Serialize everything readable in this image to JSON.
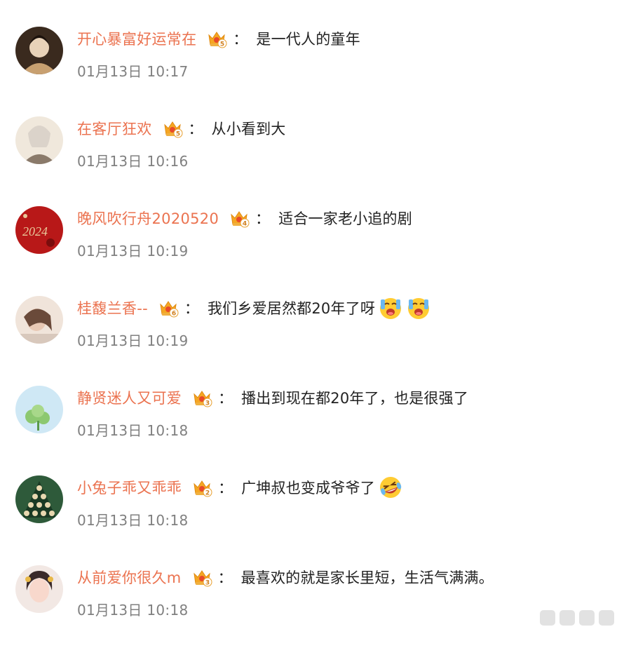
{
  "comments": [
    {
      "username": "开心暴富好运常在",
      "level": "5",
      "text": "是一代人的童年",
      "time": "01月13日 10:17",
      "emojis": [],
      "avatar_colors": [
        "#3a2a1e",
        "#c8a070",
        "#e8d2b8"
      ]
    },
    {
      "username": "在客厅狂欢",
      "level": "5",
      "text": "从小看到大",
      "time": "01月13日 10:16",
      "emojis": [],
      "avatar_colors": [
        "#d8d0c8",
        "#f0e8dc",
        "#8a7a6a"
      ]
    },
    {
      "username": "晚风吹行舟2020520",
      "level": "4",
      "text": "适合一家老小追的剧",
      "time": "01月13日 10:19",
      "emojis": [],
      "avatar_colors": [
        "#b81818",
        "#e8c89a",
        "#7a0d0d"
      ]
    },
    {
      "username": "桂馥兰香--",
      "level": "6",
      "text": "我们乡爱居然都20年了呀",
      "time": "01月13日 10:19",
      "emojis": [
        "crying-emoji",
        "crying-emoji"
      ],
      "avatar_colors": [
        "#d8c8bc",
        "#6a4a3a",
        "#f0e4da"
      ]
    },
    {
      "username": "静贤迷人又可爱",
      "level": "3",
      "text": "播出到现在都20年了，也是很强了",
      "time": "01月13日 10:18",
      "emojis": [],
      "avatar_colors": [
        "#cfe8f5",
        "#8cc870",
        "#ffffff"
      ]
    },
    {
      "username": "小兔子乖又乖乖",
      "level": "2",
      "text": "广坤叔也变成爷爷了",
      "time": "01月13日 10:18",
      "emojis": [
        "laugh-cry-emoji"
      ],
      "avatar_colors": [
        "#2e5a3a",
        "#e8d8b0",
        "#1a3a24"
      ]
    },
    {
      "username": "从前爱你很久m",
      "level": "3",
      "text": "最喜欢的就是家长里短，生活气满满。",
      "time": "01月13日 10:18",
      "emojis": [],
      "avatar_colors": [
        "#f2e8e4",
        "#3a2a2a",
        "#f8d8cc"
      ]
    }
  ],
  "colon": "："
}
